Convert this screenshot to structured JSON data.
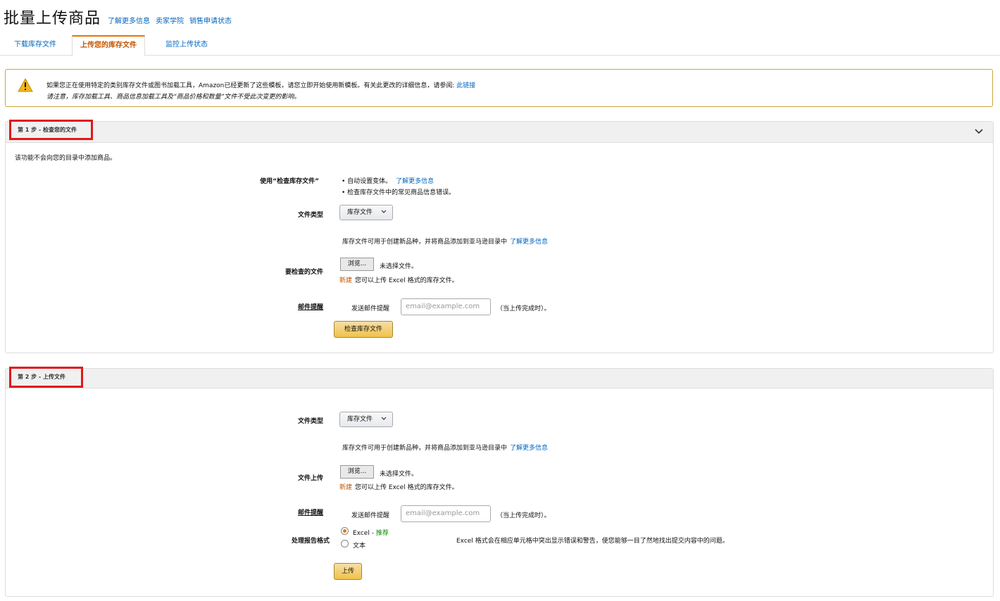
{
  "header": {
    "title": "批量上传商品",
    "links": [
      "了解更多信息",
      "卖家学院",
      "销售申请状态"
    ]
  },
  "tabs": [
    "下载库存文件",
    "上传您的库存文件",
    "监控上传状态"
  ],
  "alert": {
    "line1": "如果您正在使用特定的类别库存文件或图书加载工具，Amazon已经更新了这些模板，请您立即开始使用新模板。有关此更改的详细信息，请参阅: ",
    "link": "此链接",
    "line2": "请注意，库存加载工具、商品信息加载工具及“商品价格和数量”文件不受此次变更的影响。"
  },
  "step1": {
    "title": "第 1 步 - 检查您的文件",
    "intro": "该功能不会向您的目录中添加商品。",
    "use_label": "使用“检查库存文件”",
    "bullet1": "• 自动设置变体。",
    "bullet1_link": "了解更多信息",
    "bullet2": "• 检查库存文件中的常见商品信息错误。",
    "file_type_label": "文件类型",
    "file_type_value": "库存文件",
    "file_type_hint": "库存文件可用于创建新品种，并将商品添加到亚马逊目录中",
    "file_type_link": "了解更多信息",
    "file_label": "要检查的文件",
    "browse_label": "浏览...",
    "no_file": "未选择文件。",
    "new_tag": "新建",
    "excel_note": "您可以上传 Excel 格式的库存文件。",
    "email_label": "邮件提醒",
    "email_prefix": "发送邮件提醒",
    "email_placeholder": "email@example.com",
    "email_suffix": "（当上传完成时）。",
    "check_button": "检查库存文件"
  },
  "step2": {
    "title": "第 2 步 - 上传文件",
    "file_type_label": "文件类型",
    "file_type_value": "库存文件",
    "file_type_hint": "库存文件可用于创建新品种，并将商品添加到亚马逊目录中",
    "file_type_link": "了解更多信息",
    "upload_label": "文件上传",
    "browse_label": "浏览...",
    "no_file": "未选择文件。",
    "new_tag": "新建",
    "excel_note": "您可以上传 Excel 格式的库存文件。",
    "email_label": "邮件提醒",
    "email_prefix": "发送邮件提醒",
    "email_placeholder": "email@example.com",
    "email_suffix": "（当上传完成时）。",
    "report_label": "处理报告格式",
    "option_excel": "Excel - ",
    "option_excel_rec": "推荐",
    "option_text": "文本",
    "report_note": "Excel 格式会在相应单元格中突出显示错误和警告，使您能够一目了然地找出提交内容中的问题。",
    "upload_button": "上传"
  },
  "colors": {
    "link": "#0066c0",
    "active_tab": "#c45500",
    "highlight_box": "#e01919",
    "button": "#f0c14b"
  }
}
